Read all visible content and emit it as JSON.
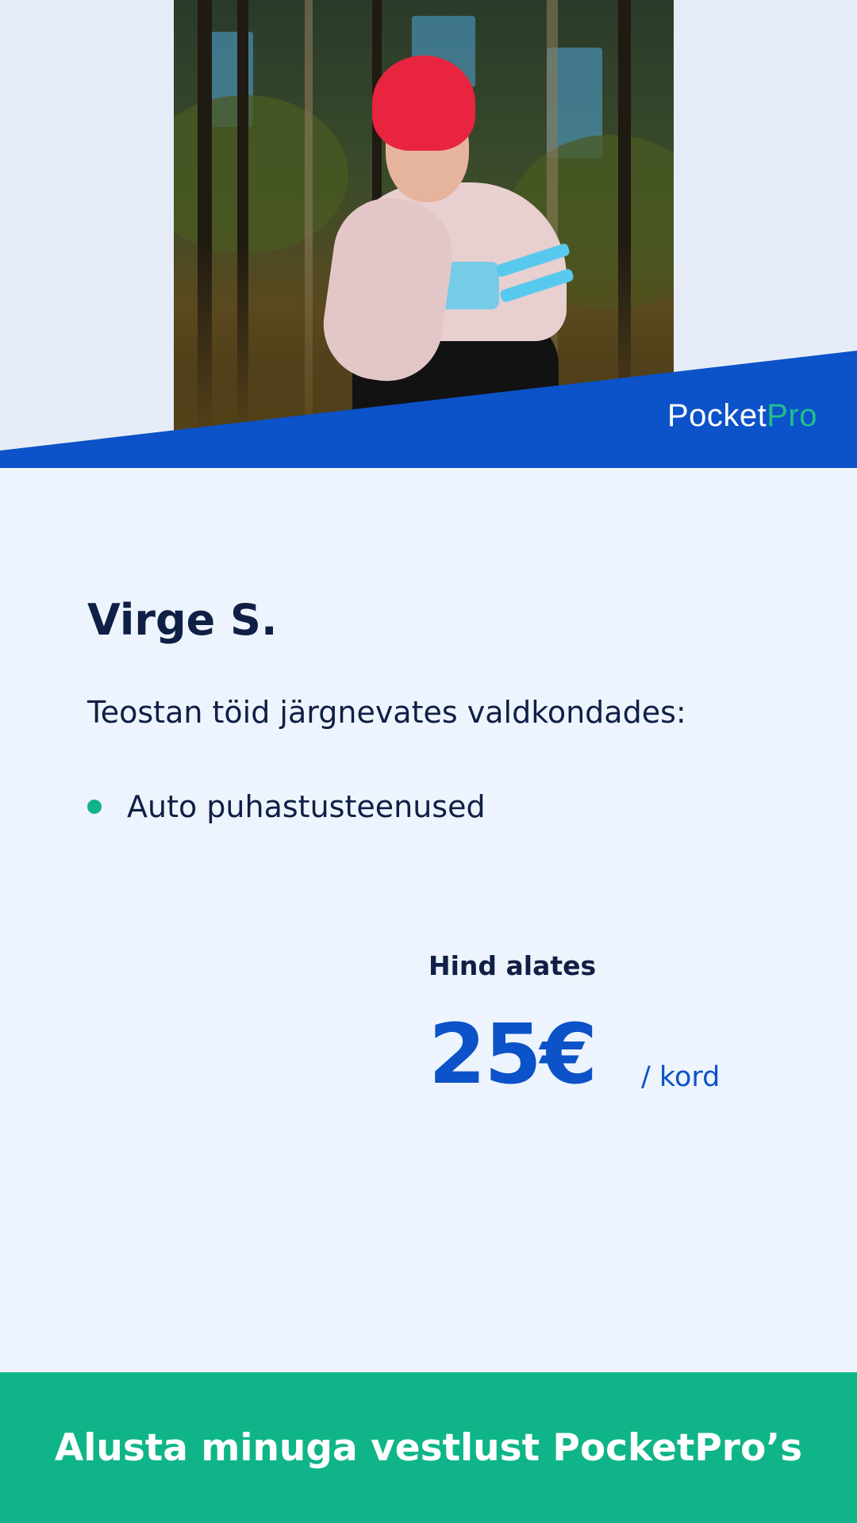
{
  "brand": {
    "logo_primary": "Pocket",
    "logo_secondary": "Pro",
    "primary_color": "#0c52c8",
    "accent_color": "#0fb588"
  },
  "profile": {
    "photo": "profile-photo",
    "name": "Virge S.",
    "intro": "Teostan töid järgnevates valdkondades:",
    "services": [
      "Auto puhastusteenused"
    ]
  },
  "pricing": {
    "label": "Hind alates",
    "amount": "25€",
    "unit": "/ kord"
  },
  "cta": {
    "label": "Alusta minuga vestlust PocketPro’s"
  }
}
